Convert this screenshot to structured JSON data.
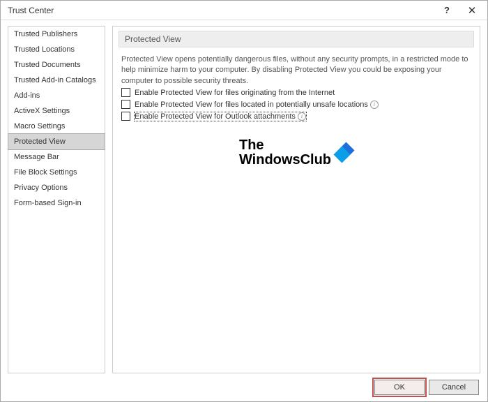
{
  "titlebar": {
    "title": "Trust Center"
  },
  "sidebar": {
    "items": [
      {
        "label": "Trusted Publishers"
      },
      {
        "label": "Trusted Locations"
      },
      {
        "label": "Trusted Documents"
      },
      {
        "label": "Trusted Add-in Catalogs"
      },
      {
        "label": "Add-ins"
      },
      {
        "label": "ActiveX Settings"
      },
      {
        "label": "Macro Settings"
      },
      {
        "label": "Protected View",
        "selected": true
      },
      {
        "label": "Message Bar"
      },
      {
        "label": "File Block Settings"
      },
      {
        "label": "Privacy Options"
      },
      {
        "label": "Form-based Sign-in"
      }
    ]
  },
  "main": {
    "section_title": "Protected View",
    "description": "Protected View opens potentially dangerous files, without any security prompts, in a restricted mode to help minimize harm to your computer. By disabling Protected View you could be exposing your computer to possible security threats.",
    "checkboxes": [
      {
        "label": "Enable Protected View for files originating from the Internet",
        "checked": false,
        "info": false
      },
      {
        "label": "Enable Protected View for files located in potentially unsafe locations",
        "checked": false,
        "info": true
      },
      {
        "label": "Enable Protected View for Outlook attachments",
        "checked": false,
        "info": true,
        "focused": true
      }
    ]
  },
  "watermark": {
    "line1": "The",
    "line2": "WindowsClub"
  },
  "buttons": {
    "ok": "OK",
    "cancel": "Cancel"
  }
}
